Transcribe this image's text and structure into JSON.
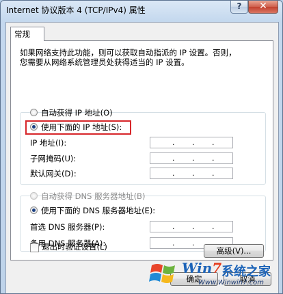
{
  "window": {
    "title": "Internet 协议版本 4 (TCP/IPv4) 属性",
    "help_glyph": "?",
    "close_glyph": "✕"
  },
  "tab": {
    "label": "常规"
  },
  "description": {
    "line1": "如果网络支持此功能，则可以获取自动指派的 IP 设置。否则，",
    "line2": "您需要从网络系统管理员处获得适当的 IP 设置。"
  },
  "ip_section": {
    "auto_option": "自动获得 IP 地址(O)",
    "manual_option": "使用下面的 IP 地址(S):",
    "selected": "manual",
    "fields": [
      {
        "label": "IP 地址(I):"
      },
      {
        "label": "子网掩码(U):"
      },
      {
        "label": "默认网关(D):"
      }
    ]
  },
  "dns_section": {
    "auto_option": "自动获得 DNS 服务器地址(B)",
    "manual_option": "使用下面的 DNS 服务器地址(E):",
    "selected": "manual",
    "fields": [
      {
        "label": "首选 DNS 服务器(P):"
      },
      {
        "label": "备用 DNS 服务器(A):"
      }
    ]
  },
  "validate": {
    "label": "退出时验证设置(L)",
    "checked": false
  },
  "buttons": {
    "advanced": "高级(V)...",
    "ok": "确定",
    "cancel": "取消"
  },
  "ip_dot": ".",
  "watermark": {
    "brand": "Win7",
    "brand_main": "Win",
    "brand_num": "7",
    "site_name": "系统之家",
    "url": "Www.Winwin7.com"
  },
  "colors": {
    "highlight_border": "#d7262a",
    "title_bar": "#c4d8ee",
    "panel_bg": "#ffffff"
  }
}
